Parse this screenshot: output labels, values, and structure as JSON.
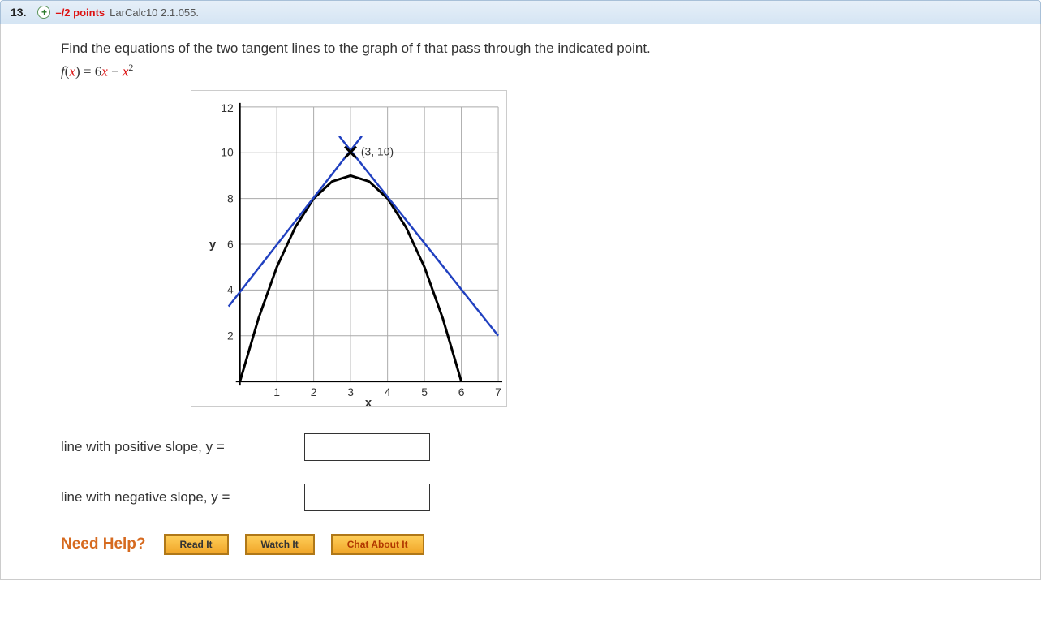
{
  "header": {
    "number": "13.",
    "icon": "+",
    "points": "–/2 points",
    "lesson": "LarCalc10 2.1.055."
  },
  "prompt": "Find the equations of the two tangent lines to the graph of f that pass through the indicated point.",
  "func": {
    "lhs": "f",
    "lparen": "(",
    "var": "x",
    "rparen": ") = 6",
    "var2": "x",
    "minus": " − ",
    "var3": "x",
    "exp": "2"
  },
  "chart_data": {
    "type": "line",
    "xlabel": "x",
    "ylabel": "y",
    "xlim": [
      0,
      7
    ],
    "ylim": [
      0,
      12
    ],
    "xticks": [
      1,
      2,
      3,
      4,
      5,
      6,
      7
    ],
    "yticks": [
      2,
      4,
      6,
      8,
      10,
      12
    ],
    "point_label": "(3, 10)",
    "point": [
      3,
      10
    ],
    "series": [
      {
        "name": "parabola",
        "x": [
          0,
          0.5,
          1,
          1.5,
          2,
          2.5,
          3,
          3.5,
          4,
          4.5,
          5,
          5.5,
          6
        ],
        "values": [
          0,
          2.75,
          5,
          6.75,
          8,
          8.75,
          9,
          8.75,
          8,
          6.75,
          5,
          2.75,
          0
        ],
        "color": "#000"
      },
      {
        "name": "tangent-positive",
        "x": [
          0,
          3
        ],
        "values": [
          4,
          10
        ],
        "color": "#2040c0"
      },
      {
        "name": "tangent-negative",
        "x": [
          3,
          7
        ],
        "values": [
          10,
          2
        ],
        "color": "#2040c0"
      }
    ]
  },
  "lines": {
    "pos_label": "line with positive slope,   y =",
    "neg_label": "line with negative slope,  y ="
  },
  "help": {
    "title": "Need Help?",
    "read": "Read It",
    "watch": "Watch It",
    "chat": "Chat About It"
  }
}
